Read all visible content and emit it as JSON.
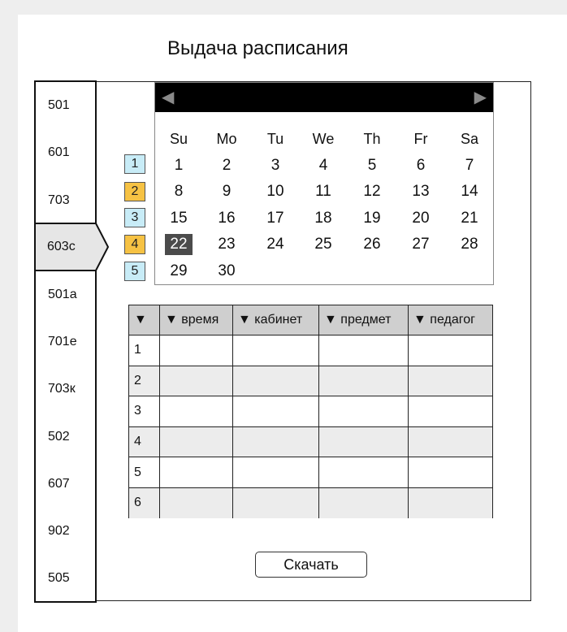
{
  "title": "Выдача расписания",
  "sidebar": {
    "items": [
      "501",
      "601",
      "703",
      "603с",
      "501а",
      "701е",
      "703к",
      "502",
      "607",
      "902",
      "505"
    ],
    "active": "603с"
  },
  "calendar": {
    "prev_icon": "left-triangle-icon",
    "next_icon": "right-triangle-icon",
    "weekdays": [
      "Su",
      "Mo",
      "Tu",
      "We",
      "Th",
      "Fr",
      "Sa"
    ],
    "weeks": [
      [
        "1",
        "2",
        "3",
        "4",
        "5",
        "6",
        "7"
      ],
      [
        "8",
        "9",
        "10",
        "11",
        "12",
        "13",
        "14"
      ],
      [
        "15",
        "16",
        "17",
        "18",
        "19",
        "20",
        "21"
      ],
      [
        "22",
        "23",
        "24",
        "25",
        "26",
        "27",
        "28"
      ],
      [
        "29",
        "30",
        "",
        "",
        "",
        "",
        ""
      ]
    ],
    "selected_day": "22",
    "week_numbers": [
      {
        "label": "1",
        "color": "#c8ecf7"
      },
      {
        "label": "2",
        "color": "#f6c244"
      },
      {
        "label": "3",
        "color": "#c8ecf7"
      },
      {
        "label": "4",
        "color": "#f6c244"
      },
      {
        "label": "5",
        "color": "#c8ecf7"
      }
    ]
  },
  "table": {
    "headers": [
      "▼",
      "▼ время",
      "▼ кабинет",
      "▼ предмет",
      "▼ педагог"
    ],
    "rows": [
      "1",
      "2",
      "3",
      "4",
      "5",
      "6"
    ]
  },
  "download_label": "Скачать"
}
